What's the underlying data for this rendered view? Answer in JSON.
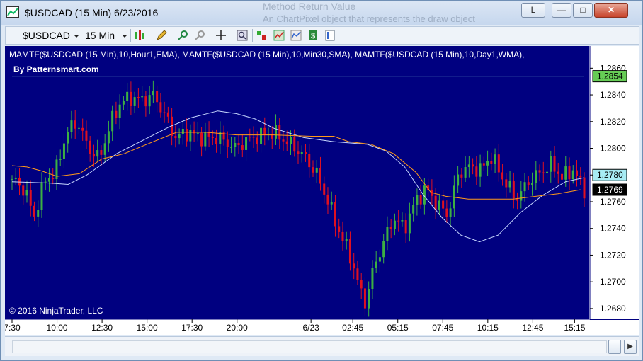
{
  "window": {
    "title": "$USDCAD (15 Min)  6/23/2016",
    "background_text_1": "Method  Return  Value",
    "background_text_2": "An ChartPixel object that represents the draw object",
    "buttons": {
      "l_label": "L",
      "minimize": "—",
      "maximize": "□",
      "close": "✕"
    }
  },
  "toolbar": {
    "instrument": "$USDCAD",
    "interval": "15 Min",
    "icons": [
      "bar-type-icon",
      "pencil-icon",
      "zoom-in-icon",
      "zoom-out-icon",
      "crosshair-icon",
      "magnifier-icon",
      "strategy-icon",
      "chart-style-icon",
      "price-marker-icon",
      "properties-icon"
    ]
  },
  "chart": {
    "indicator_label": "MAMTF($USDCAD  (15  Min),10,Hour1,EMA),   MAMTF($USDCAD  (15  Min),10,Min30,SMA),   MAMTF($USDCAD  (15  Min),10,Day1,WMA),",
    "watermark": "By Patternsmart.com",
    "copyright": "© 2016 NinjaTrader, LLC",
    "colors": {
      "background": "#000080",
      "up_candle": "#3cb043",
      "down_candle": "#e01020",
      "ema": "#c8d8ff",
      "sma": "#ff9a1a",
      "wma": "#8fe3e3",
      "grid": "#e0e0e0",
      "axis_text": "#ffffff"
    },
    "price_markers": [
      {
        "value": "1.2854",
        "bg": "#66cc55"
      },
      {
        "value": "1.2780",
        "bg": "#a8ecf4"
      },
      {
        "value": "1.2769",
        "bg": "#000000"
      }
    ]
  },
  "chart_data": {
    "type": "line",
    "title": "",
    "y_ticks": [
      "1.2860",
      "1.2840",
      "1.2820",
      "1.2800",
      "1.2780",
      "1.2760",
      "1.2740",
      "1.2720",
      "1.2700",
      "1.2680"
    ],
    "x_ticks": [
      "7:30",
      "10:00",
      "12:30",
      "15:00",
      "17:30",
      "20:00",
      "6/23",
      "02:45",
      "05:15",
      "07:45",
      "10:15",
      "12:45",
      "15:15"
    ],
    "ylim": [
      1.2672,
      1.2866
    ],
    "x_count": 155,
    "series": [
      {
        "name": "MAMTF($USDCAD  (15  Min),10,Hour1,EMA)",
        "points": [
          [
            0,
            1.2775
          ],
          [
            10,
            1.2774
          ],
          [
            15,
            1.2773
          ],
          [
            20,
            1.278
          ],
          [
            28,
            1.2796
          ],
          [
            35,
            1.2806
          ],
          [
            42,
            1.2816
          ],
          [
            48,
            1.2823
          ],
          [
            55,
            1.2828
          ],
          [
            60,
            1.2826
          ],
          [
            65,
            1.2822
          ],
          [
            70,
            1.2815
          ],
          [
            78,
            1.2808
          ],
          [
            86,
            1.2805
          ],
          [
            95,
            1.2803
          ],
          [
            100,
            1.2798
          ],
          [
            105,
            1.2786
          ],
          [
            110,
            1.2765
          ],
          [
            115,
            1.2748
          ],
          [
            120,
            1.2735
          ],
          [
            125,
            1.273
          ],
          [
            130,
            1.2735
          ],
          [
            136,
            1.2752
          ],
          [
            142,
            1.2765
          ],
          [
            148,
            1.2775
          ],
          [
            153,
            1.2778
          ]
        ]
      },
      {
        "name": "MAMTF($USDCAD  (15  Min),10,Min30,SMA)",
        "points": [
          [
            0,
            1.2787
          ],
          [
            4,
            1.2786
          ],
          [
            8,
            1.2783
          ],
          [
            12,
            1.2779
          ],
          [
            18,
            1.2781
          ],
          [
            24,
            1.2792
          ],
          [
            30,
            1.2796
          ],
          [
            36,
            1.2803
          ],
          [
            44,
            1.2812
          ],
          [
            52,
            1.2812
          ],
          [
            60,
            1.281
          ],
          [
            70,
            1.281
          ],
          [
            80,
            1.2809
          ],
          [
            86,
            1.2809
          ],
          [
            90,
            1.2805
          ],
          [
            96,
            1.2803
          ],
          [
            102,
            1.2796
          ],
          [
            108,
            1.2782
          ],
          [
            112,
            1.2767
          ],
          [
            116,
            1.2764
          ],
          [
            122,
            1.2762
          ],
          [
            128,
            1.2762
          ],
          [
            134,
            1.2762
          ],
          [
            140,
            1.2764
          ],
          [
            146,
            1.2766
          ],
          [
            152,
            1.2769
          ]
        ]
      },
      {
        "name": "MAMTF($USDCAD  (15  Min),10,Day1,WMA)",
        "points": [
          [
            0,
            1.2854
          ],
          [
            153,
            1.2854
          ]
        ]
      }
    ],
    "candles_summary": "15-min OHLC candles, high ~1.2852, low ~1.2678, last ~1.2769"
  }
}
